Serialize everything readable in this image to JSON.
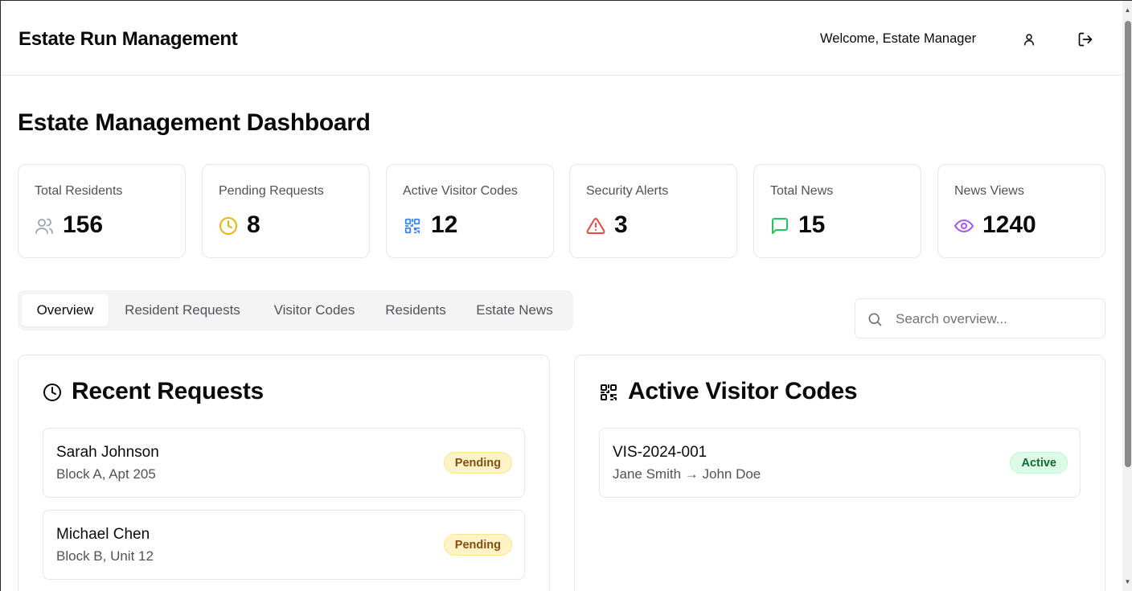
{
  "header": {
    "app_title": "Estate Run Management",
    "welcome": "Welcome, Estate Manager",
    "user_icon": "user-icon",
    "logout_icon": "logout-icon"
  },
  "page": {
    "title": "Estate Management Dashboard"
  },
  "stats": [
    {
      "label": "Total Residents",
      "value": "156",
      "icon": "users-icon",
      "color": "#9ca3af"
    },
    {
      "label": "Pending Requests",
      "value": "8",
      "icon": "clock-icon",
      "color": "#eab308"
    },
    {
      "label": "Active Visitor Codes",
      "value": "12",
      "icon": "qr-code-icon",
      "color": "#3b82f6"
    },
    {
      "label": "Security Alerts",
      "value": "3",
      "icon": "alert-triangle-icon",
      "color": "#ef4444"
    },
    {
      "label": "Total News",
      "value": "15",
      "icon": "message-square-icon",
      "color": "#22c55e"
    },
    {
      "label": "News Views",
      "value": "1240",
      "icon": "eye-icon",
      "color": "#a855f7"
    }
  ],
  "tabs": [
    {
      "label": "Overview",
      "active": true
    },
    {
      "label": "Resident Requests",
      "active": false
    },
    {
      "label": "Visitor Codes",
      "active": false
    },
    {
      "label": "Residents",
      "active": false
    },
    {
      "label": "Estate News",
      "active": false
    }
  ],
  "search": {
    "placeholder": "Search overview...",
    "value": ""
  },
  "recent_requests": {
    "title": "Recent Requests",
    "items": [
      {
        "name": "Sarah Johnson",
        "location": "Block A, Apt 205",
        "status": "Pending"
      },
      {
        "name": "Michael Chen",
        "location": "Block B, Unit 12",
        "status": "Pending"
      }
    ]
  },
  "active_visitor_codes": {
    "title": "Active Visitor Codes",
    "items": [
      {
        "code": "VIS-2024-001",
        "route": "Jane Smith → John Doe",
        "status": "Active"
      }
    ]
  },
  "colors": {
    "pending_bg": "#fef3c7",
    "pending_text": "#854d0e",
    "active_bg": "#dcfce7",
    "active_text": "#166534",
    "border": "#e5e7eb"
  }
}
